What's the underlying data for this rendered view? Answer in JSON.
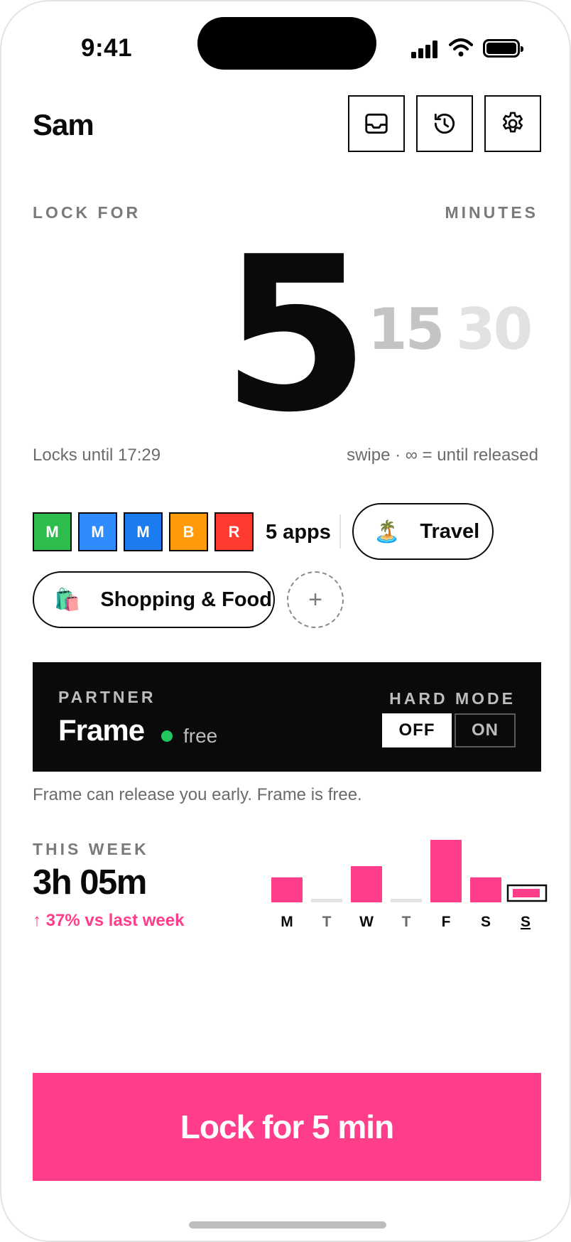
{
  "status_bar": {
    "time": "9:41"
  },
  "header": {
    "user_name": "Sam",
    "buttons": [
      {
        "icon": "inbox-icon"
      },
      {
        "icon": "history-icon"
      },
      {
        "icon": "gear-icon"
      }
    ]
  },
  "lock": {
    "label": "LOCK FOR",
    "unit_label": "MINUTES",
    "selected": "5",
    "options": [
      "15",
      "30"
    ],
    "option_colors": [
      "#c4c4c4",
      "#e2e2e2"
    ],
    "locks_until": "Locks until 17:29",
    "hint": "swipe · ∞ = until released"
  },
  "apps": {
    "tiles": [
      {
        "letter": "M",
        "color": "#2ebd4c"
      },
      {
        "letter": "M",
        "color": "#2f8cff"
      },
      {
        "letter": "M",
        "color": "#1a7cf0"
      },
      {
        "letter": "B",
        "color": "#ff9a0a"
      },
      {
        "letter": "R",
        "color": "#ff3b30"
      }
    ],
    "count": "5 apps",
    "groups": [
      {
        "emoji": "🏝️",
        "label": "Travel"
      },
      {
        "emoji": "🛍️",
        "label": "Shopping & Food"
      }
    ],
    "add": "+"
  },
  "partner": {
    "label": "PARTNER",
    "name": "Frame",
    "presence": "free",
    "hard_mode_label": "HARD MODE",
    "off": "OFF",
    "on": "ON",
    "note": "Frame can release you early. Frame is free."
  },
  "week": {
    "label": "THIS WEEK",
    "total": "3h 05m",
    "delta": "↑ 37% vs last week"
  },
  "chart_data": {
    "type": "bar",
    "categories": [
      "M",
      "T",
      "W",
      "T",
      "F",
      "S",
      "S"
    ],
    "values": [
      0.4,
      0,
      0.58,
      0,
      1.0,
      0.4,
      0.14
    ],
    "highlight_index": 6,
    "accent": "#ff3d8b"
  },
  "cta": {
    "label": "Lock for 5 min"
  }
}
